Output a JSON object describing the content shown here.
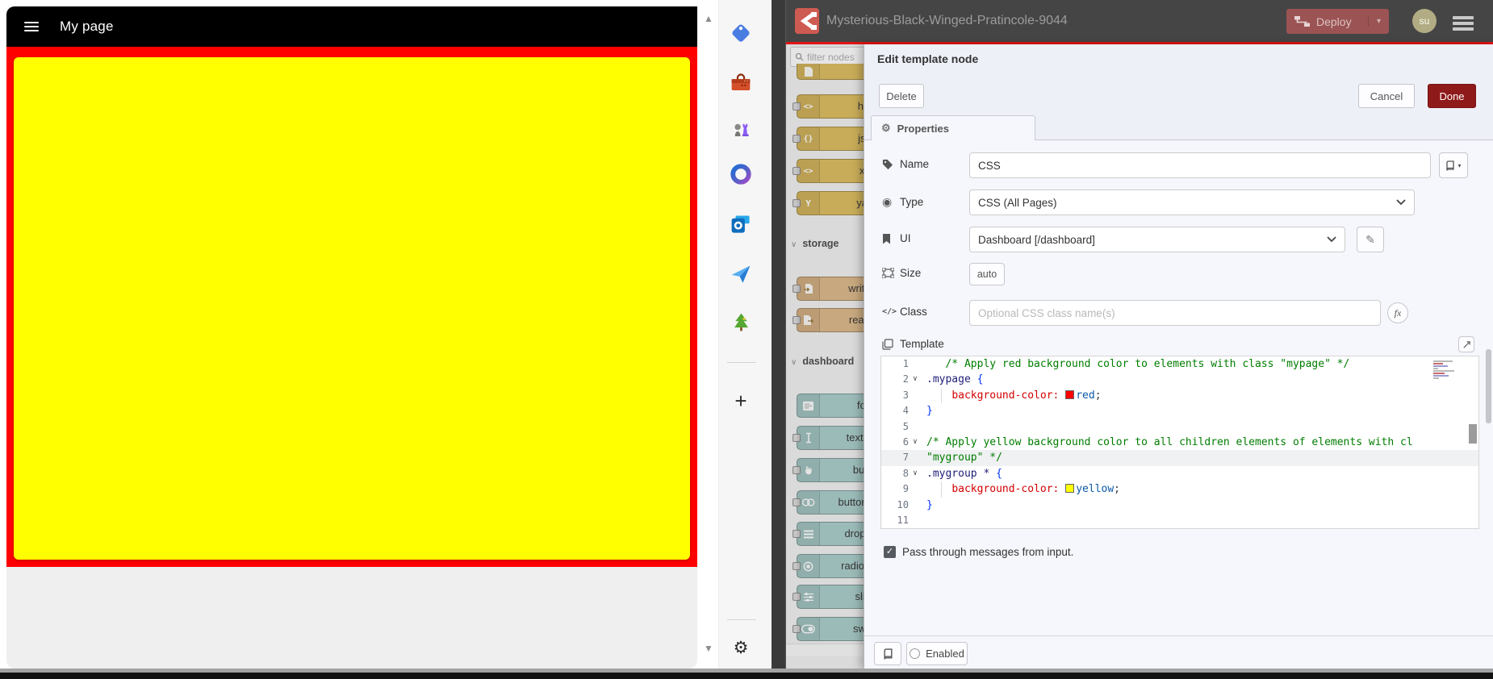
{
  "dashboard": {
    "page_title": "My page",
    "colors": {
      "page_bg": "#fe0000",
      "group_bg": "#ffff00",
      "header_bg": "#000000"
    }
  },
  "browser_sidebar": {
    "icons": [
      "shopping-tag",
      "toolbox",
      "games",
      "microsoft-365",
      "outlook",
      "messaging",
      "tree"
    ]
  },
  "nodered": {
    "header": {
      "title": "Mysterious-Black-Winged-Pratincole-9044",
      "deploy_label": "Deploy",
      "avatar_label": "su"
    },
    "palette": {
      "filter_placeholder": "filter nodes",
      "items": [
        {
          "kind": "node",
          "label": "",
          "icon": "file",
          "color": "tan",
          "partial": true
        },
        {
          "kind": "node",
          "label": "html",
          "icon": "angle",
          "color": "tan"
        },
        {
          "kind": "node",
          "label": "json",
          "icon": "braces",
          "color": "tan"
        },
        {
          "kind": "node",
          "label": "xml",
          "icon": "angle",
          "color": "tan"
        },
        {
          "kind": "node",
          "label": "yaml",
          "icon": "yletter",
          "color": "tan"
        },
        {
          "kind": "section",
          "label": "storage"
        },
        {
          "kind": "node",
          "label": "write file",
          "icon": "file-export",
          "color": "brown"
        },
        {
          "kind": "node",
          "label": "read file",
          "icon": "file-import",
          "color": "brown"
        },
        {
          "kind": "section",
          "label": "dashboard"
        },
        {
          "kind": "node",
          "label": "form",
          "icon": "form",
          "color": "teal",
          "noport": true
        },
        {
          "kind": "node",
          "label": "text input",
          "icon": "ibeam",
          "color": "teal"
        },
        {
          "kind": "node",
          "label": "button",
          "icon": "hand",
          "color": "teal"
        },
        {
          "kind": "node",
          "label": "button group",
          "icon": "button-group",
          "color": "teal"
        },
        {
          "kind": "node",
          "label": "dropdown",
          "icon": "list",
          "color": "teal"
        },
        {
          "kind": "node",
          "label": "radio group",
          "icon": "radio",
          "color": "teal"
        },
        {
          "kind": "node",
          "label": "slider",
          "icon": "sliders",
          "color": "teal"
        },
        {
          "kind": "node",
          "label": "switch",
          "icon": "switch",
          "color": "teal"
        }
      ],
      "colors": {
        "tan": "#DEBD5C",
        "brown": "#DEB887",
        "teal": "#A9CECB"
      }
    },
    "tray": {
      "title": "Edit template node",
      "buttons": {
        "delete": "Delete",
        "cancel": "Cancel",
        "done": "Done"
      },
      "tab": "Properties",
      "fields": {
        "name": {
          "label": "Name",
          "value": "CSS"
        },
        "type": {
          "label": "Type",
          "value": "CSS (All Pages)"
        },
        "ui": {
          "label": "UI",
          "value": "Dashboard [/dashboard]"
        },
        "size": {
          "label": "Size",
          "value": "auto"
        },
        "class": {
          "label": "Class",
          "placeholder": "Optional CSS class name(s)"
        },
        "template": {
          "label": "Template"
        }
      },
      "code": {
        "lines": [
          {
            "n": 1,
            "tokens": [
              [
                "comment",
                "   /* Apply red background color to elements with class \"mypage\" */"
              ]
            ]
          },
          {
            "n": 2,
            "fold": true,
            "tokens": [
              [
                "selector",
                ".mypage"
              ],
              [
                "plain",
                " "
              ],
              [
                "bracket",
                "{"
              ]
            ]
          },
          {
            "n": 3,
            "tokens": [
              [
                "plain",
                "    "
              ],
              [
                "property",
                "background-color:"
              ],
              [
                "plain",
                " "
              ],
              [
                "swatch",
                "#ff0000"
              ],
              [
                "value",
                "red"
              ],
              [
                "punct",
                ";"
              ]
            ]
          },
          {
            "n": 4,
            "tokens": [
              [
                "bracket",
                "}"
              ]
            ]
          },
          {
            "n": 5,
            "tokens": []
          },
          {
            "n": 6,
            "fold": true,
            "tokens": [
              [
                "comment",
                "/* Apply yellow background color to all children elements of elements with cl"
              ]
            ]
          },
          {
            "n": 7,
            "active": true,
            "tokens": [
              [
                "comment",
                "\"mygroup\" */"
              ]
            ]
          },
          {
            "n": 8,
            "fold": true,
            "tokens": [
              [
                "selector",
                ".mygroup *"
              ],
              [
                "plain",
                " "
              ],
              [
                "bracket",
                "{"
              ]
            ]
          },
          {
            "n": 9,
            "tokens": [
              [
                "plain",
                "    "
              ],
              [
                "property",
                "background-color:"
              ],
              [
                "plain",
                " "
              ],
              [
                "swatch",
                "#ffff00"
              ],
              [
                "value",
                "yellow"
              ],
              [
                "punct",
                ";"
              ]
            ]
          },
          {
            "n": 10,
            "tokens": [
              [
                "bracket",
                "}"
              ]
            ]
          },
          {
            "n": 11,
            "tokens": []
          }
        ]
      },
      "passthrough_label": "Pass through messages from input.",
      "enabled_label": "Enabled"
    }
  }
}
